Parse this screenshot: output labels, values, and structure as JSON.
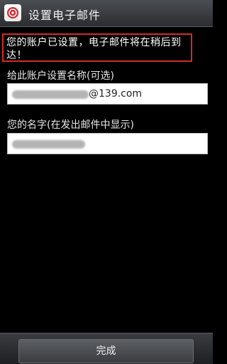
{
  "header": {
    "title": "设置电子邮件",
    "icon": "email-app-icon"
  },
  "notice": {
    "text": "您的账户已设置，电子邮件将在稍后到达！",
    "border_color": "#d42a2a"
  },
  "account_name": {
    "label": "给此账户设置名称(可选)",
    "value": "@139.com"
  },
  "your_name": {
    "label": "您的名字(在发出邮件中显示)"
  },
  "footer": {
    "done_label": "完成"
  }
}
